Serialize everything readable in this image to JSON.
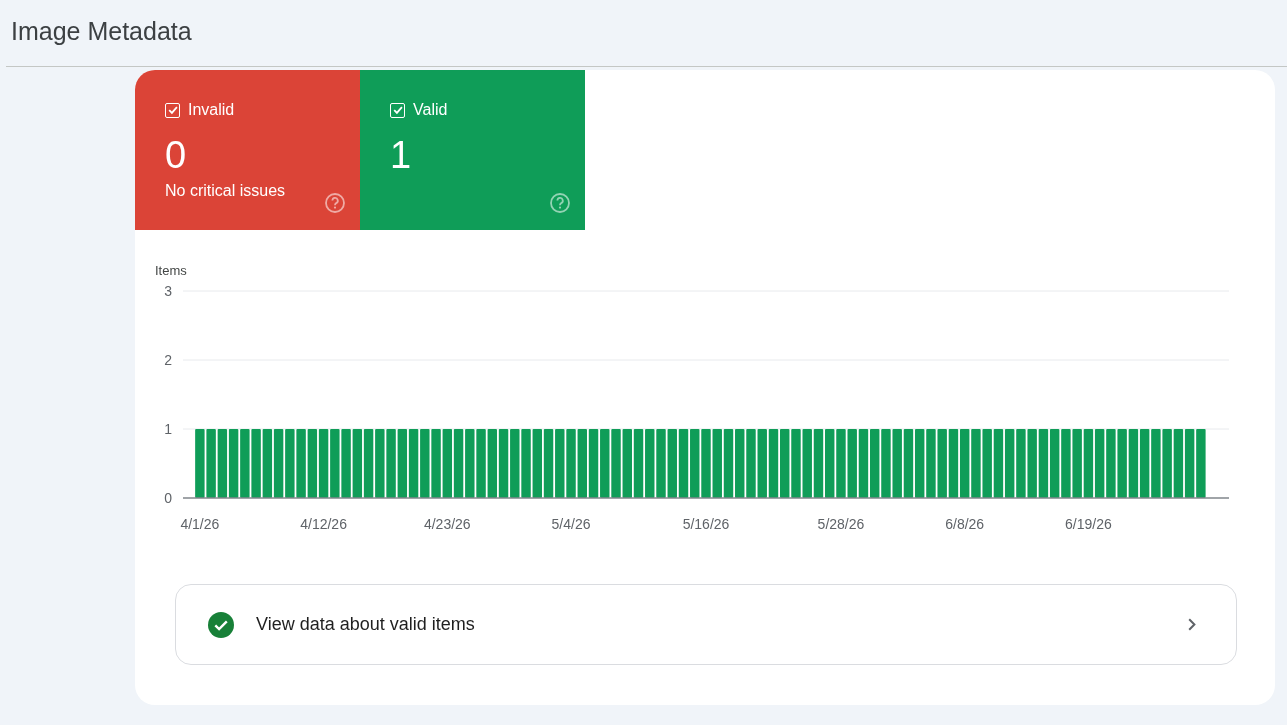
{
  "page": {
    "title": "Image Metadata"
  },
  "status_tiles": [
    {
      "label": "Invalid",
      "checked": true,
      "color": "#db4437",
      "count": "0",
      "detail": "No critical issues"
    },
    {
      "label": "Valid",
      "checked": true,
      "color": "#0f9d58",
      "count": "1"
    }
  ],
  "chart": {
    "chart_data": {
      "type": "bar",
      "ylabel": "Items",
      "ylim": [
        0,
        3
      ],
      "yticks": [
        0,
        1,
        2,
        3
      ],
      "categories": [
        "4/1/26",
        null,
        null,
        null,
        null,
        null,
        null,
        null,
        null,
        null,
        null,
        "4/12/26",
        null,
        null,
        null,
        null,
        null,
        null,
        null,
        null,
        null,
        null,
        "4/23/26",
        null,
        null,
        null,
        null,
        null,
        null,
        null,
        null,
        null,
        null,
        "5/4/26",
        null,
        null,
        null,
        null,
        null,
        null,
        null,
        null,
        null,
        null,
        null,
        "5/16/26",
        null,
        null,
        null,
        null,
        null,
        null,
        null,
        null,
        null,
        null,
        null,
        "5/28/26",
        null,
        null,
        null,
        null,
        null,
        null,
        null,
        null,
        null,
        null,
        "6/8/26",
        null,
        null,
        null,
        null,
        null,
        null,
        null,
        null,
        null,
        null,
        "6/19/26",
        null,
        null,
        null,
        null,
        null,
        null,
        null,
        null,
        null,
        null
      ],
      "values": [
        1,
        1,
        1,
        1,
        1,
        1,
        1,
        1,
        1,
        1,
        1,
        1,
        1,
        1,
        1,
        1,
        1,
        1,
        1,
        1,
        1,
        1,
        1,
        1,
        1,
        1,
        1,
        1,
        1,
        1,
        1,
        1,
        1,
        1,
        1,
        1,
        1,
        1,
        1,
        1,
        1,
        1,
        1,
        1,
        1,
        1,
        1,
        1,
        1,
        1,
        1,
        1,
        1,
        1,
        1,
        1,
        1,
        1,
        1,
        1,
        1,
        1,
        1,
        1,
        1,
        1,
        1,
        1,
        1,
        1,
        1,
        1,
        1,
        1,
        1,
        1,
        1,
        1,
        1,
        1,
        1,
        1,
        1,
        1,
        1,
        1,
        1,
        1,
        1,
        1
      ]
    }
  },
  "details_link": {
    "label": "View data about valid items"
  }
}
